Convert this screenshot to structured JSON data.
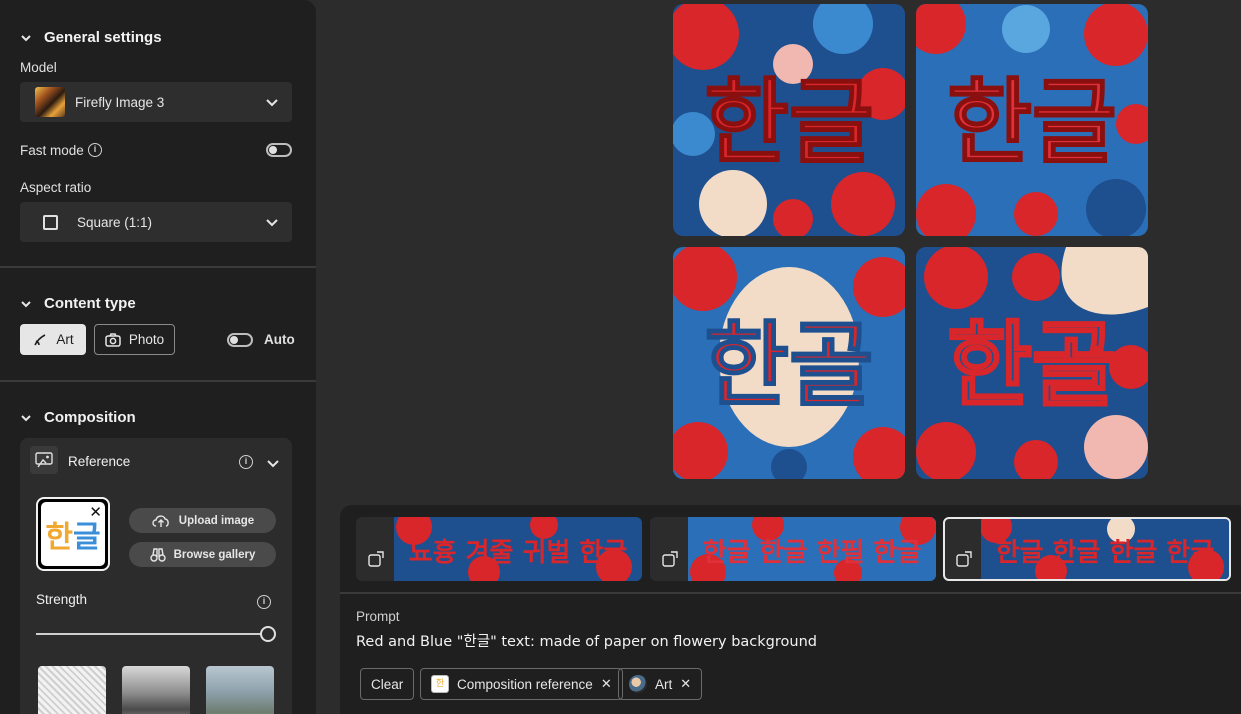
{
  "panel": {
    "general": {
      "title": "General settings",
      "model_label": "Model",
      "model_value": "Firefly Image 3",
      "fast_mode_label": "Fast mode",
      "aspect_label": "Aspect ratio",
      "aspect_value": "Square (1:1)"
    },
    "content_type": {
      "title": "Content type",
      "art_label": "Art",
      "photo_label": "Photo",
      "auto_label": "Auto"
    },
    "composition": {
      "title": "Composition",
      "reference_label": "Reference",
      "upload_label": "Upload image",
      "browse_label": "Browse gallery",
      "strength_label": "Strength",
      "strength_value": 1.0
    }
  },
  "grid_text": [
    "한글",
    "한글",
    "한골",
    "한골"
  ],
  "strips": [
    {
      "text": "뇨흉 겨줄 귀벌 한글"
    },
    {
      "text": "한글 한글 한필 한글"
    },
    {
      "text": "한글 한글 한글 한글"
    }
  ],
  "prompt": {
    "label": "Prompt",
    "text": "Red and Blue \"한글\" text: made of paper on flowery background"
  },
  "chips": {
    "clear": "Clear",
    "composition": "Composition reference",
    "art": "Art"
  },
  "colors": {
    "red": "#d8262b",
    "blue": "#1e5aa8",
    "cream": "#f2dcc8"
  }
}
